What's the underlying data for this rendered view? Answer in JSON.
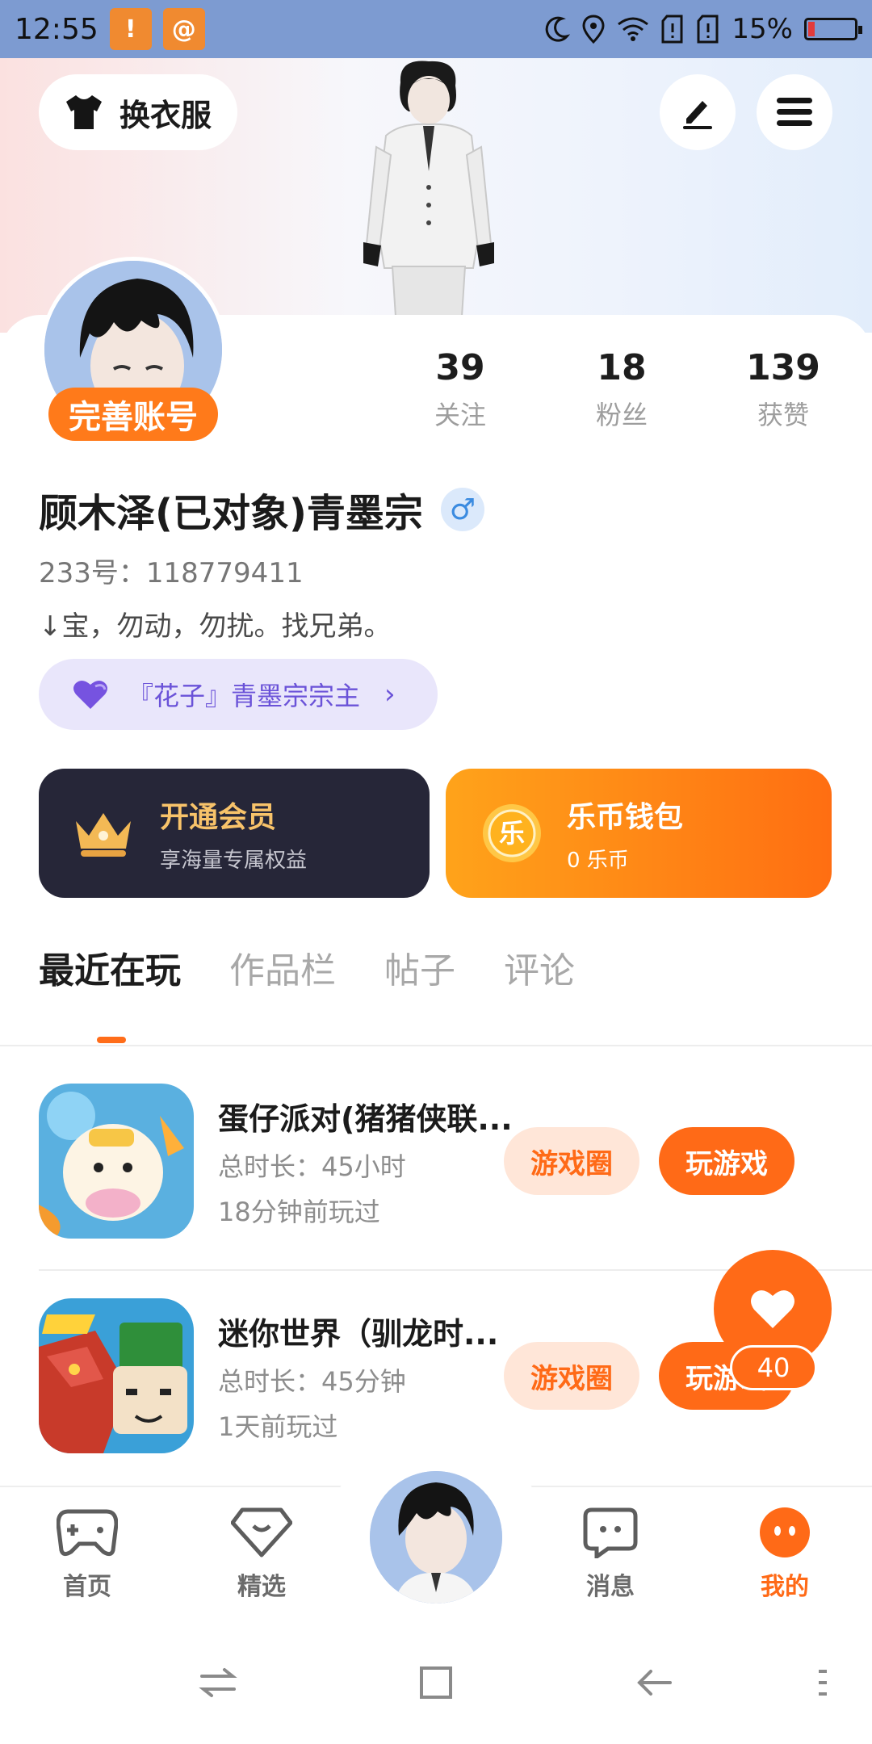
{
  "status_bar": {
    "time": "12:55",
    "battery": "15%",
    "battery_level": 0.15
  },
  "header": {
    "outfit_label": "换衣服"
  },
  "profile": {
    "complete_label": "完善账号",
    "stats": [
      {
        "value": "39",
        "label": "关注"
      },
      {
        "value": "18",
        "label": "粉丝"
      },
      {
        "value": "139",
        "label": "获赞"
      }
    ],
    "nickname": "顾木泽(已对象)青墨宗",
    "gender_symbol": "♂",
    "uid": "233号：118779411",
    "bio": "↓宝，勿动，勿扰。找兄弟。",
    "title_chip": "『花子』青墨宗宗主"
  },
  "cards": {
    "vip": {
      "title": "开通会员",
      "subtitle": "享海量专属权益"
    },
    "wallet": {
      "title": "乐币钱包",
      "subtitle": "0 乐币",
      "coin_char": "乐"
    }
  },
  "tabs": [
    "最近在玩",
    "作品栏",
    "帖子",
    "评论"
  ],
  "games": [
    {
      "name": "蛋仔派对(猪猪侠联...",
      "duration": "总时长：45小时",
      "last_played": "18分钟前玩过",
      "circle_label": "游戏圈",
      "play_label": "玩游戏"
    },
    {
      "name": "迷你世界（驯龙时...",
      "duration": "总时长：45分钟",
      "last_played": "1天前玩过",
      "circle_label": "游戏圈",
      "play_label": "玩游戏"
    }
  ],
  "like_fab": {
    "count": "40"
  },
  "bottom_nav": {
    "items": [
      {
        "label": "首页"
      },
      {
        "label": "精选"
      },
      {
        "label": "消息"
      },
      {
        "label": "我的"
      }
    ]
  },
  "colors": {
    "accent": "#ff6a17",
    "status_bar": "#7d9bd1",
    "vip_bg": "#262638"
  }
}
